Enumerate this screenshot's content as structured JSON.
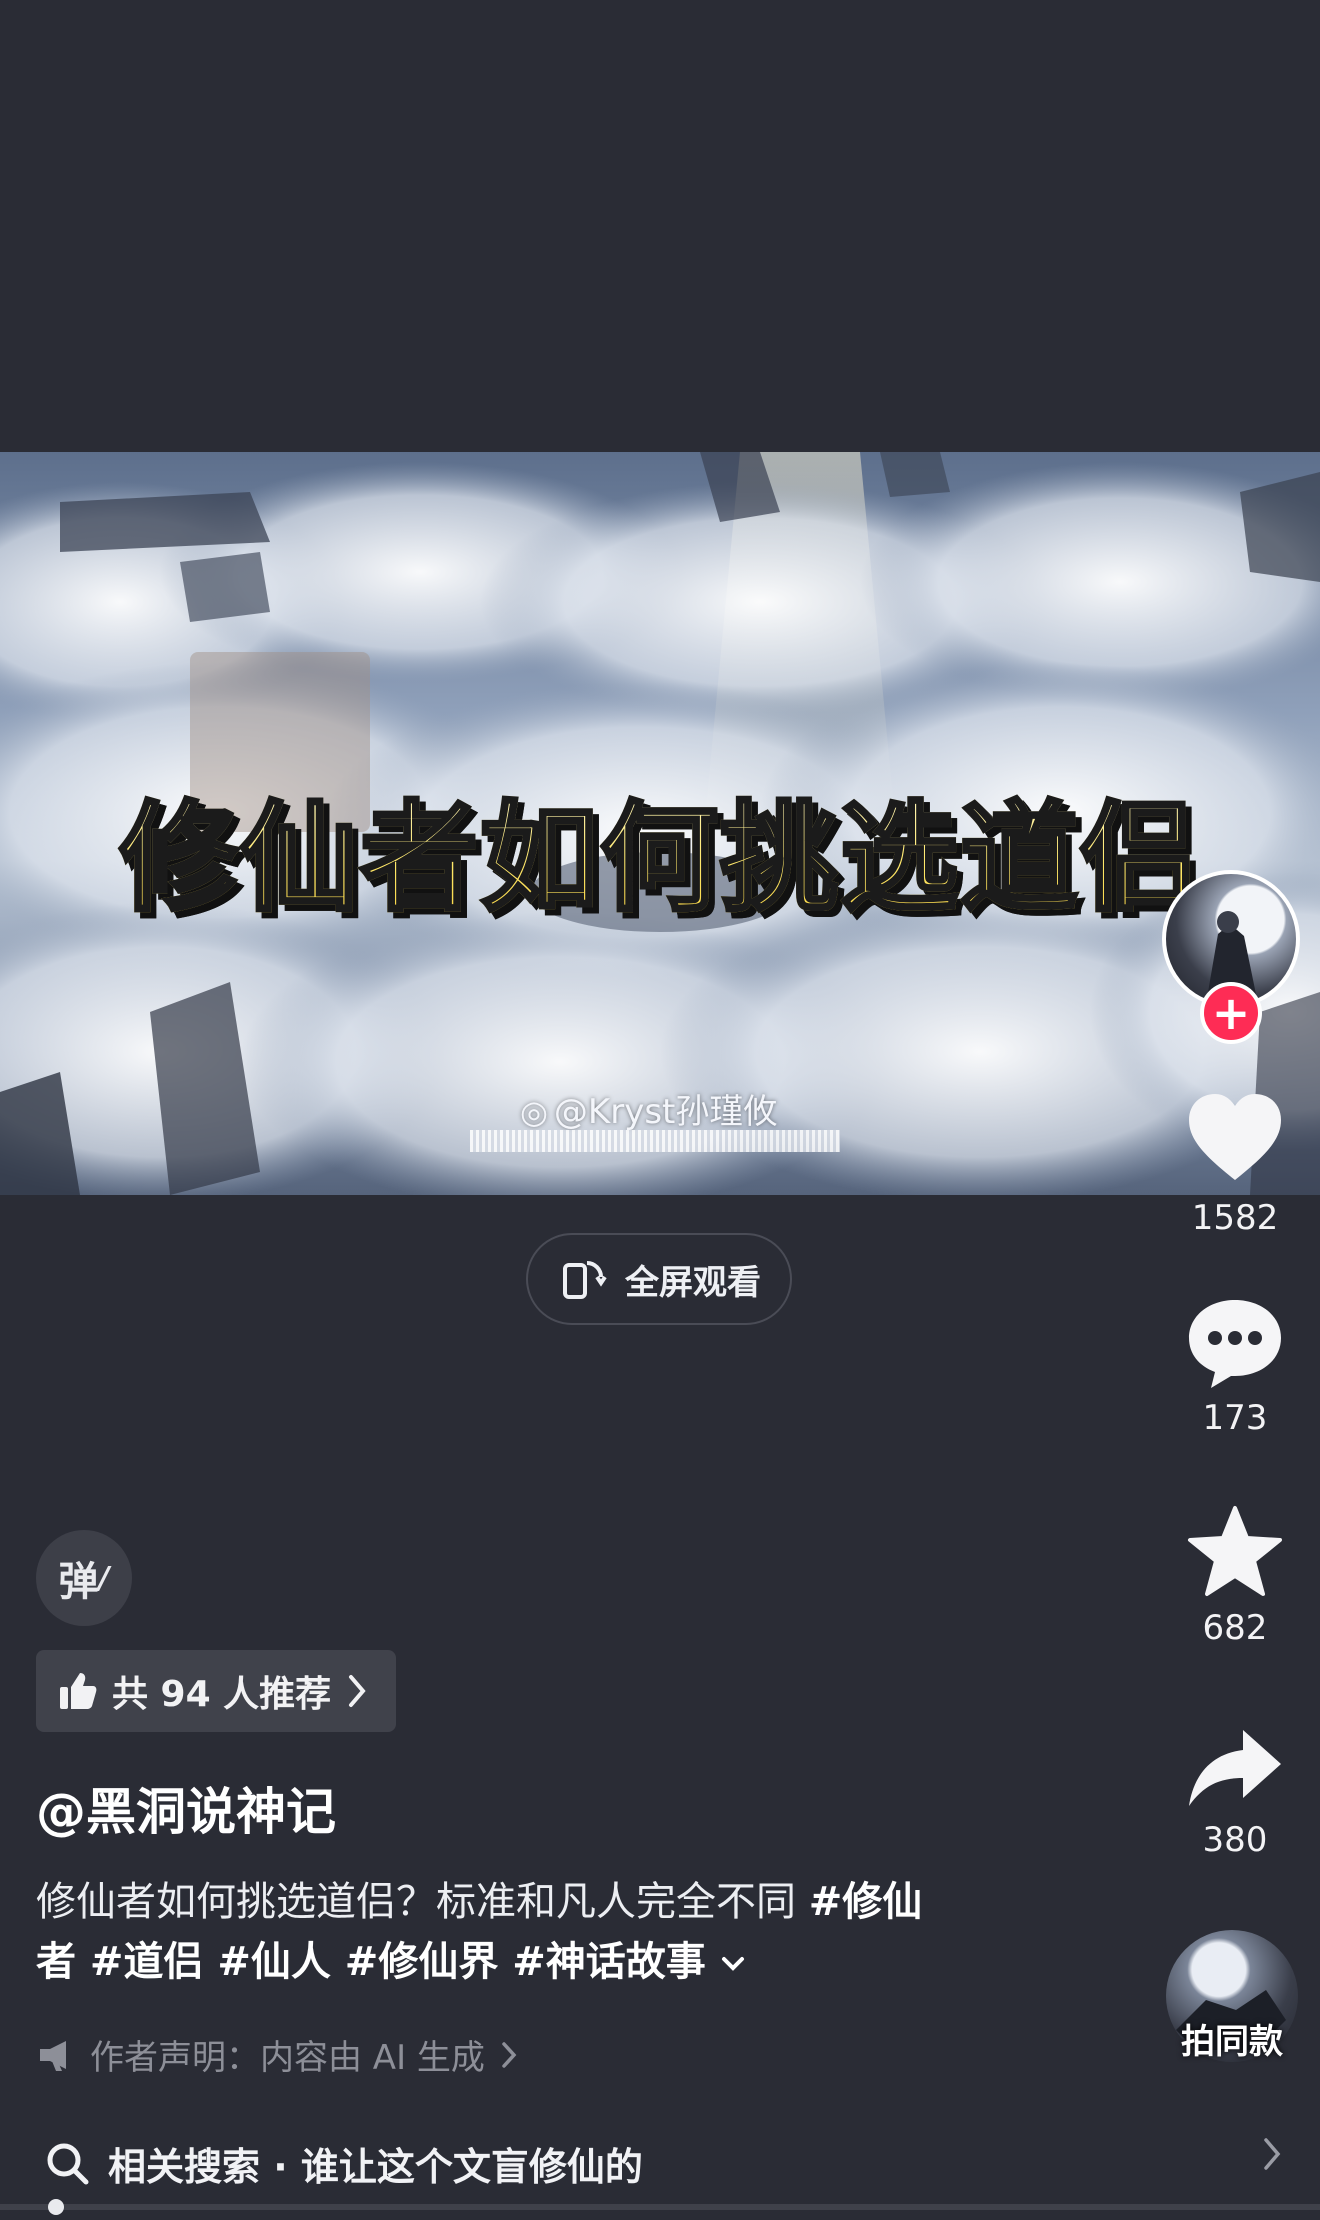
{
  "video": {
    "overlay_title": "修仙者如何挑选道侣",
    "watermark": "@Kryst孙瑾攸"
  },
  "fullscreen": {
    "label": "全屏观看"
  },
  "actions": {
    "likes": "1582",
    "comments": "173",
    "favorites": "682",
    "shares": "380",
    "follow_symbol": "+"
  },
  "danmu": {
    "label": "弹"
  },
  "recommend": {
    "text": "共 94 人推荐"
  },
  "post": {
    "author": "@黑洞说神记",
    "description": "修仙者如何挑选道侣？标准和凡人完全不同",
    "hashtags_line1": "#修仙",
    "hashtags_line2": "者 #道侣 #仙人 #修仙界 #神话故事",
    "declaration": "作者声明：内容由 AI 生成"
  },
  "same_style": {
    "label": "拍同款"
  },
  "related_search": {
    "text": "相关搜索 · 谁让这个文盲修仙的"
  },
  "playback": {
    "progress": 0.03
  },
  "colors": {
    "background": "#2a2c35",
    "follow": "#fe2c55",
    "title_fill": "#ffe86a"
  }
}
